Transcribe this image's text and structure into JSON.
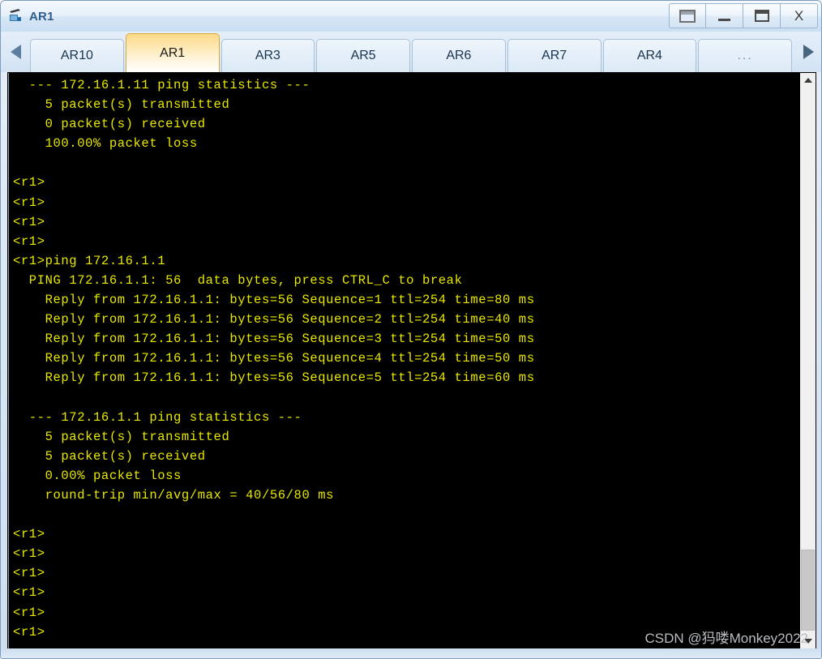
{
  "window": {
    "title": "AR1",
    "app_icon": "router-device-icon",
    "buttons": [
      {
        "name": "restore-button",
        "icon": "restore-window-icon",
        "label": ""
      },
      {
        "name": "minimize-button",
        "icon": "minimize-icon",
        "label": ""
      },
      {
        "name": "maximize-button",
        "icon": "maximize-icon",
        "label": ""
      },
      {
        "name": "close-button",
        "icon": "close-icon",
        "label": "X"
      }
    ]
  },
  "tabbar": {
    "scroll_left_icon": "triangle-left-icon",
    "scroll_right_icon": "triangle-right-icon",
    "tabs": [
      {
        "label": "AR10",
        "active": false
      },
      {
        "label": "AR1",
        "active": true
      },
      {
        "label": "AR3",
        "active": false
      },
      {
        "label": "AR5",
        "active": false
      },
      {
        "label": "AR6",
        "active": false
      },
      {
        "label": "AR7",
        "active": false
      },
      {
        "label": "AR4",
        "active": false
      },
      {
        "label": "...",
        "active": false
      }
    ]
  },
  "terminal": {
    "foreground_color": "#e8e800",
    "background_color": "#000000",
    "content": "  --- 172.16.1.11 ping statistics ---\n    5 packet(s) transmitted\n    0 packet(s) received\n    100.00% packet loss\n\n<r1>\n<r1>\n<r1>\n<r1>\n<r1>ping 172.16.1.1\n  PING 172.16.1.1: 56  data bytes, press CTRL_C to break\n    Reply from 172.16.1.1: bytes=56 Sequence=1 ttl=254 time=80 ms\n    Reply from 172.16.1.1: bytes=56 Sequence=2 ttl=254 time=40 ms\n    Reply from 172.16.1.1: bytes=56 Sequence=3 ttl=254 time=50 ms\n    Reply from 172.16.1.1: bytes=56 Sequence=4 ttl=254 time=50 ms\n    Reply from 172.16.1.1: bytes=56 Sequence=5 ttl=254 time=60 ms\n\n  --- 172.16.1.1 ping statistics ---\n    5 packet(s) transmitted\n    5 packet(s) received\n    0.00% packet loss\n    round-trip min/avg/max = 40/56/80 ms\n\n<r1>\n<r1>\n<r1>\n<r1>\n<r1>\n<r1>"
  },
  "scrollbar": {
    "up_icon": "chevron-up-icon",
    "down_icon": "chevron-down-icon"
  },
  "watermark": {
    "text": "CSDN @犸喽Monkey2022"
  }
}
